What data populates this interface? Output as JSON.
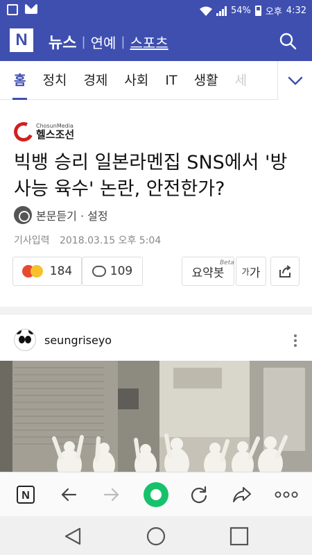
{
  "status_bar": {
    "battery": "54%",
    "ampm": "오후",
    "time": "4:32"
  },
  "app_bar": {
    "logo": "N",
    "tabs": [
      {
        "label": "뉴스",
        "active": true
      },
      {
        "label": "연예",
        "active": false
      },
      {
        "label": "스포츠",
        "active": false
      }
    ]
  },
  "categories": [
    "홈",
    "정치",
    "경제",
    "사회",
    "IT",
    "생활",
    "세"
  ],
  "article": {
    "brand_small": "ChosunMedia",
    "brand_name": "헬스조선",
    "headline": "빅뱅 승리 일본라멘집 SNS에서 '방사능 육수' 논란, 안전한가?",
    "listen": "본문듣기 · 설정",
    "date_label": "기사입력",
    "date_value": "2018.03.15 오후 5:04",
    "reaction_count": "184",
    "comment_count": "109",
    "summary_label": "요약봇",
    "summary_badge": "Beta",
    "font_label_small": "가",
    "font_label_big": "가"
  },
  "post": {
    "author": "seungriseyo"
  },
  "colors": {
    "brand": "#3f4fb0",
    "accent_green": "#15c26b",
    "brand_red": "#d21f1f"
  },
  "icons": {
    "bottom_nav": [
      "naver-home-icon",
      "back-arrow-icon",
      "forward-arrow-icon",
      "green-circle-icon",
      "refresh-icon",
      "share-icon",
      "more-dots-icon"
    ],
    "system_nav": [
      "system-back-icon",
      "system-home-icon",
      "system-recents-icon"
    ]
  }
}
